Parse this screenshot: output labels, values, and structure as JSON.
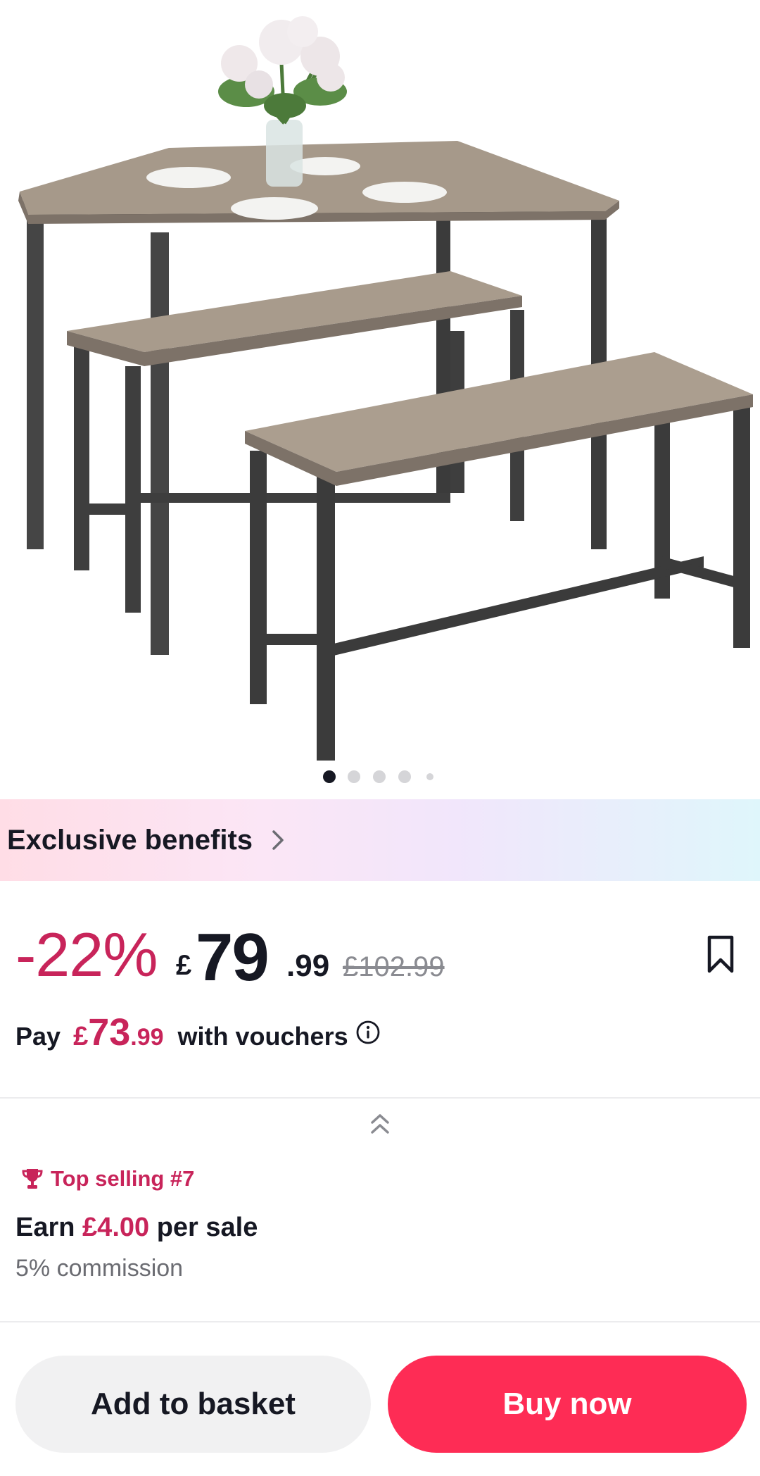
{
  "gallery": {
    "image_alt": "Dining table with two benches",
    "dot_count": 5,
    "active_dot": 0
  },
  "benefits": {
    "label": "Exclusive benefits"
  },
  "price": {
    "discount": "-22%",
    "currency_symbol": "£",
    "integer": "79",
    "decimal": ".99",
    "original": "£102.99"
  },
  "voucher": {
    "pay_label": "Pay",
    "currency_symbol": "£",
    "integer": "73",
    "decimal": ".99",
    "suffix": "with vouchers"
  },
  "affiliate": {
    "top_selling": "Top selling #7",
    "earn_prefix": "Earn",
    "earn_amount": "£4.00",
    "earn_suffix": "per sale",
    "commission": "5% commission"
  },
  "actions": {
    "add_to_basket": "Add to basket",
    "buy_now": "Buy now"
  },
  "colors": {
    "accent_pink": "#c8245a",
    "buy_button": "#fe2c55",
    "basket_button": "#f1f1f2"
  },
  "icons": [
    "chevron-right-icon",
    "bookmark-icon",
    "info-icon",
    "double-chevron-up-icon",
    "trophy-icon"
  ]
}
